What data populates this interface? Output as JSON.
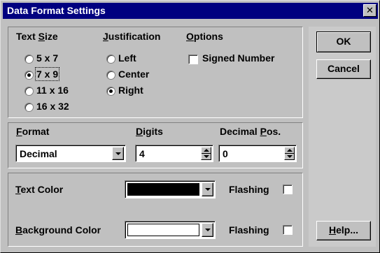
{
  "window": {
    "title": "Data Format Settings",
    "close_glyph": "✕"
  },
  "text_size": {
    "label_prefix": "Text ",
    "label_hotkey": "S",
    "label_suffix": "ize",
    "options": [
      "5 x 7",
      "7 x 9",
      "11 x 16",
      "16 x 32"
    ],
    "selected": "7 x 9"
  },
  "justification": {
    "label_hotkey": "J",
    "label_suffix": "ustification",
    "options": [
      "Left",
      "Center",
      "Right"
    ],
    "selected": "Right"
  },
  "options_group": {
    "label_hotkey": "O",
    "label_suffix": "ptions",
    "signed_number_label": "Signed Number",
    "signed_number_checked": false
  },
  "format": {
    "label_hotkey": "F",
    "label_suffix": "ormat",
    "value": "Decimal"
  },
  "digits": {
    "label_hotkey": "D",
    "label_suffix": "igits",
    "value": "4"
  },
  "decimal_pos": {
    "label_prefix": "Decimal ",
    "label_hotkey": "P",
    "label_suffix": "os.",
    "value": "0"
  },
  "text_color": {
    "label_hotkey": "T",
    "label_suffix": "ext Color",
    "color": "#000000",
    "flashing_label": "Flashing",
    "flashing_checked": false
  },
  "background_color": {
    "label_hotkey": "B",
    "label_suffix": "ackground Color",
    "color": "#ffffff",
    "flashing_label": "Flashing",
    "flashing_checked": false
  },
  "buttons": {
    "ok": "OK",
    "cancel": "Cancel",
    "help_hotkey": "H",
    "help_suffix": "elp..."
  },
  "icons": [
    "close-icon",
    "radio-icon",
    "checkbox-icon",
    "dropdown-arrow-icon",
    "spin-up-icon",
    "spin-down-icon"
  ]
}
